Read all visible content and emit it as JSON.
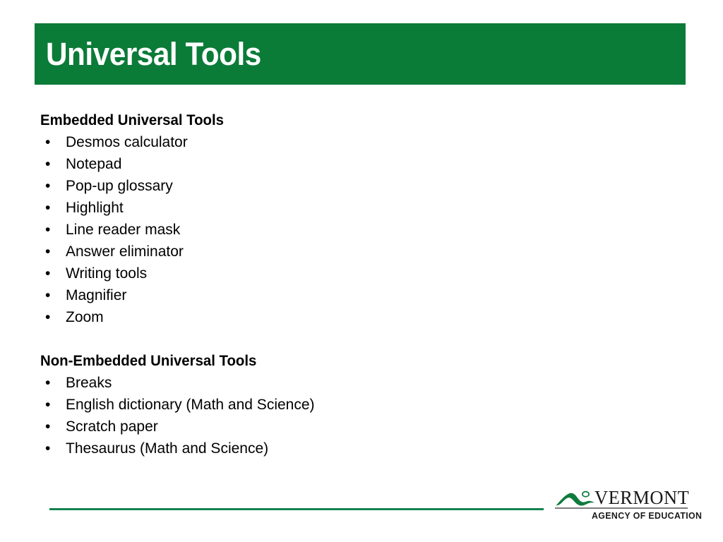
{
  "slide": {
    "title": "Universal Tools",
    "accent_color": "#0b7b38",
    "rule_color": "#138352",
    "text_color": "#000000",
    "background_color": "#ffffff"
  },
  "sections": [
    {
      "heading": "Embedded Universal Tools",
      "bullet_glyph": "•",
      "items": [
        "Desmos calculator",
        "Notepad",
        "Pop-up glossary",
        "Highlight",
        "Line reader mask",
        "Answer eliminator",
        "Writing tools",
        "Magnifier",
        "Zoom"
      ]
    },
    {
      "heading": "Non-Embedded Universal Tools",
      "bullet_glyph": "•",
      "items": [
        "Breaks",
        "English dictionary (Math and Science)",
        "Scratch paper",
        "Thesaurus (Math and Science)"
      ]
    }
  ],
  "logo": {
    "mark_name": "vermont-mountain-icon",
    "mark_color": "#0f7a3d",
    "wordmark": "VERMONT",
    "subtitle": "AGENCY OF EDUCATION",
    "divider_color": "#7d7d7d"
  }
}
